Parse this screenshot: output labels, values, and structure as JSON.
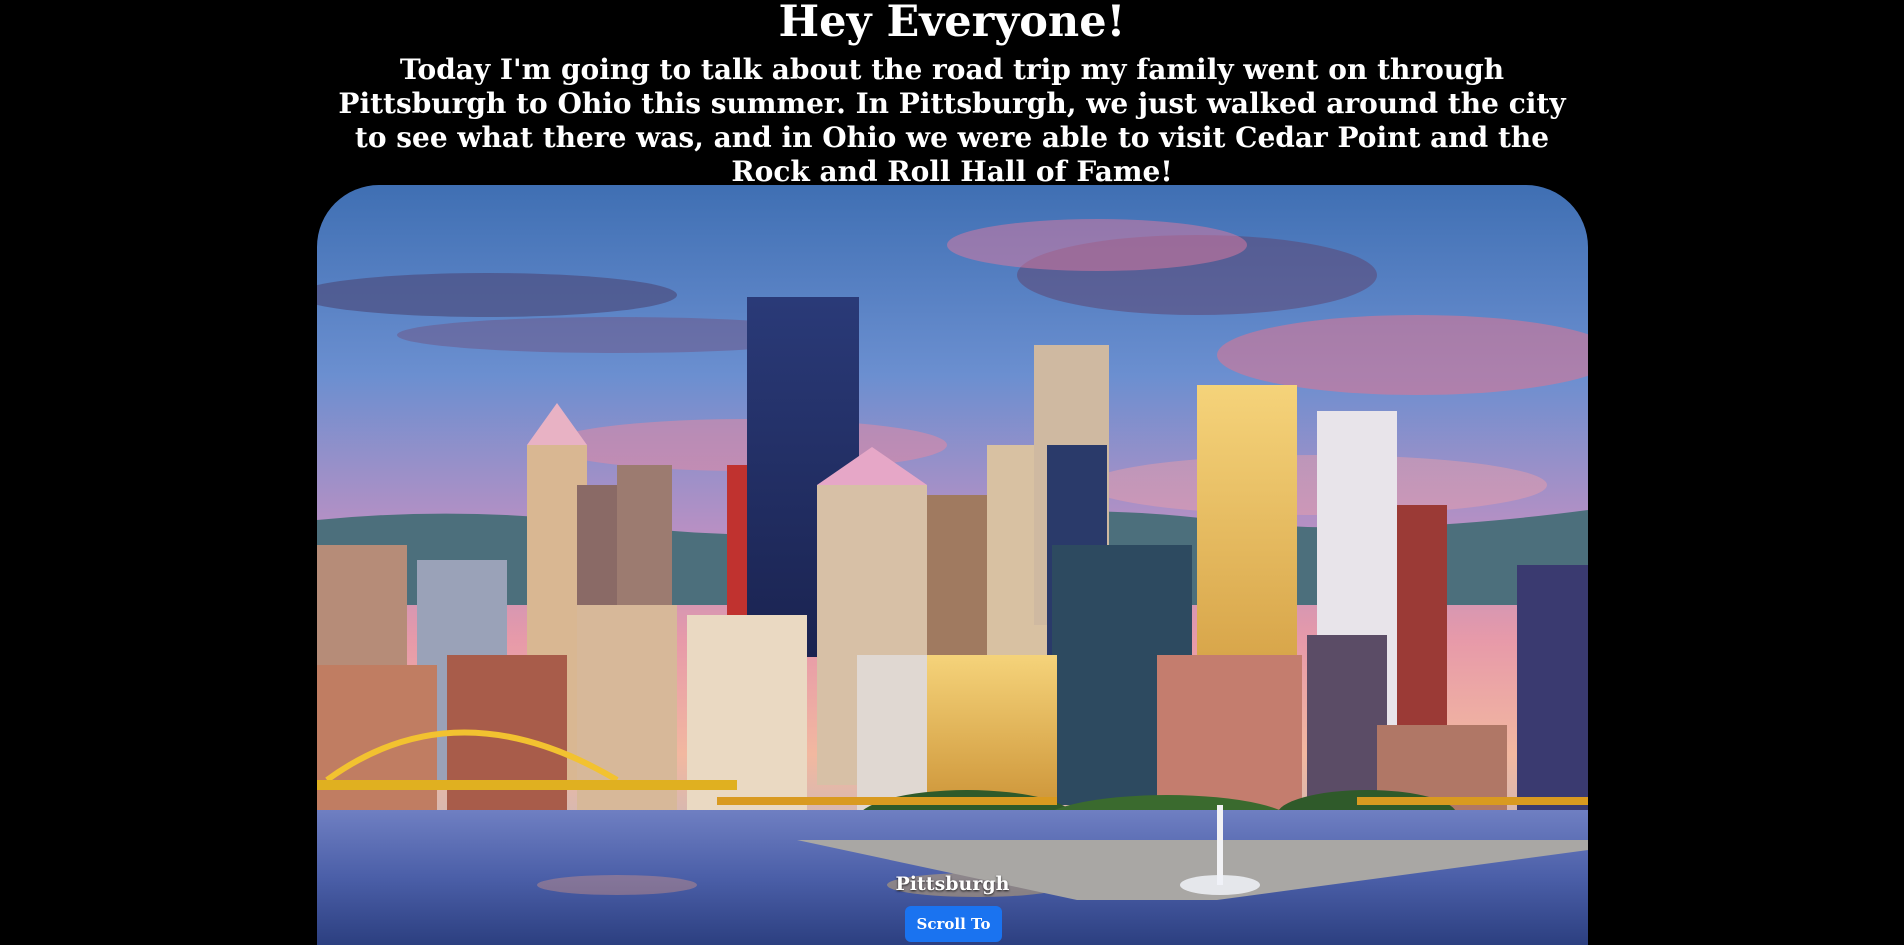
{
  "header": {
    "title": "Hey Everyone!",
    "intro": "Today I'm going to talk about the road trip my family went on through Pittsburgh to Ohio this summer. In Pittsburgh, we just walked around the city to see what there was, and in Ohio we were able to visit Cedar Point and the Rock and Roll Hall of Fame!"
  },
  "carousel": {
    "caption": "Pittsburgh",
    "button_label": "Scroll To"
  },
  "colors": {
    "background": "#000000",
    "text": "#ffffff",
    "button": "#1a73f0"
  }
}
